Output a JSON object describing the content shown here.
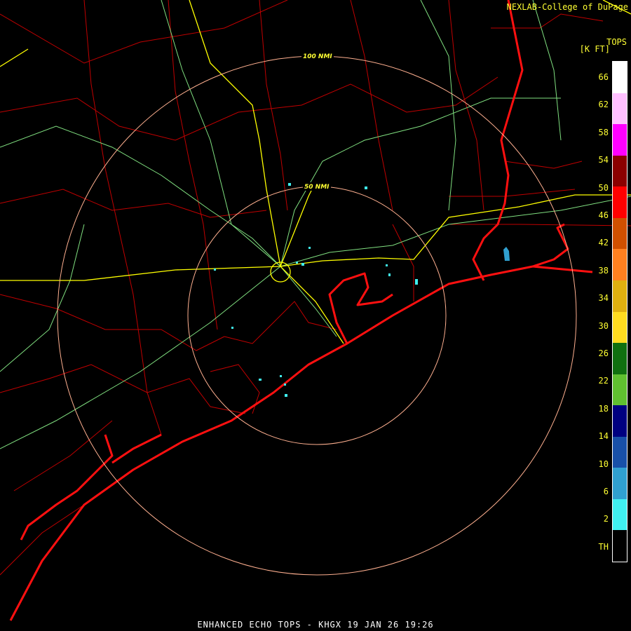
{
  "credit": "NEXLAB-College of DuPage",
  "legend": {
    "title": "TOPS",
    "units": "[K FT]",
    "entries": [
      {
        "label": "66",
        "color": "#ffffff"
      },
      {
        "label": "62",
        "color": "#ffc0ff"
      },
      {
        "label": "58",
        "color": "#ff00ff"
      },
      {
        "label": "54",
        "color": "#8b0000"
      },
      {
        "label": "50",
        "color": "#ff0000"
      },
      {
        "label": "46",
        "color": "#d05000"
      },
      {
        "label": "42",
        "color": "#ff8020"
      },
      {
        "label": "38",
        "color": "#e0b010"
      },
      {
        "label": "34",
        "color": "#ffdc20"
      },
      {
        "label": "30",
        "color": "#107010"
      },
      {
        "label": "26",
        "color": "#60c030"
      },
      {
        "label": "22",
        "color": "#000080"
      },
      {
        "label": "18",
        "color": "#1850a8"
      },
      {
        "label": "14",
        "color": "#30a0d0"
      },
      {
        "label": "10",
        "color": "#40f0f0"
      },
      {
        "label": "6",
        "color": "#000000"
      }
    ],
    "tick_labels": [
      "66",
      "62",
      "58",
      "54",
      "50",
      "46",
      "42",
      "38",
      "34",
      "30",
      "26",
      "22",
      "18",
      "14",
      "10",
      "6",
      "2",
      "TH"
    ]
  },
  "rings": {
    "inner": "50 NMI",
    "outer": "100 NMI"
  },
  "caption": "ENHANCED ECHO TOPS - KHGX 19 JAN 26 19:26",
  "colors": {
    "coast": "#ff1010",
    "county": "#d00000",
    "highway": "#ffff00",
    "road": "#80e080",
    "ring": "#ffb090",
    "echo_low": "#40f0f0",
    "echo_mid": "#30a0d0"
  }
}
